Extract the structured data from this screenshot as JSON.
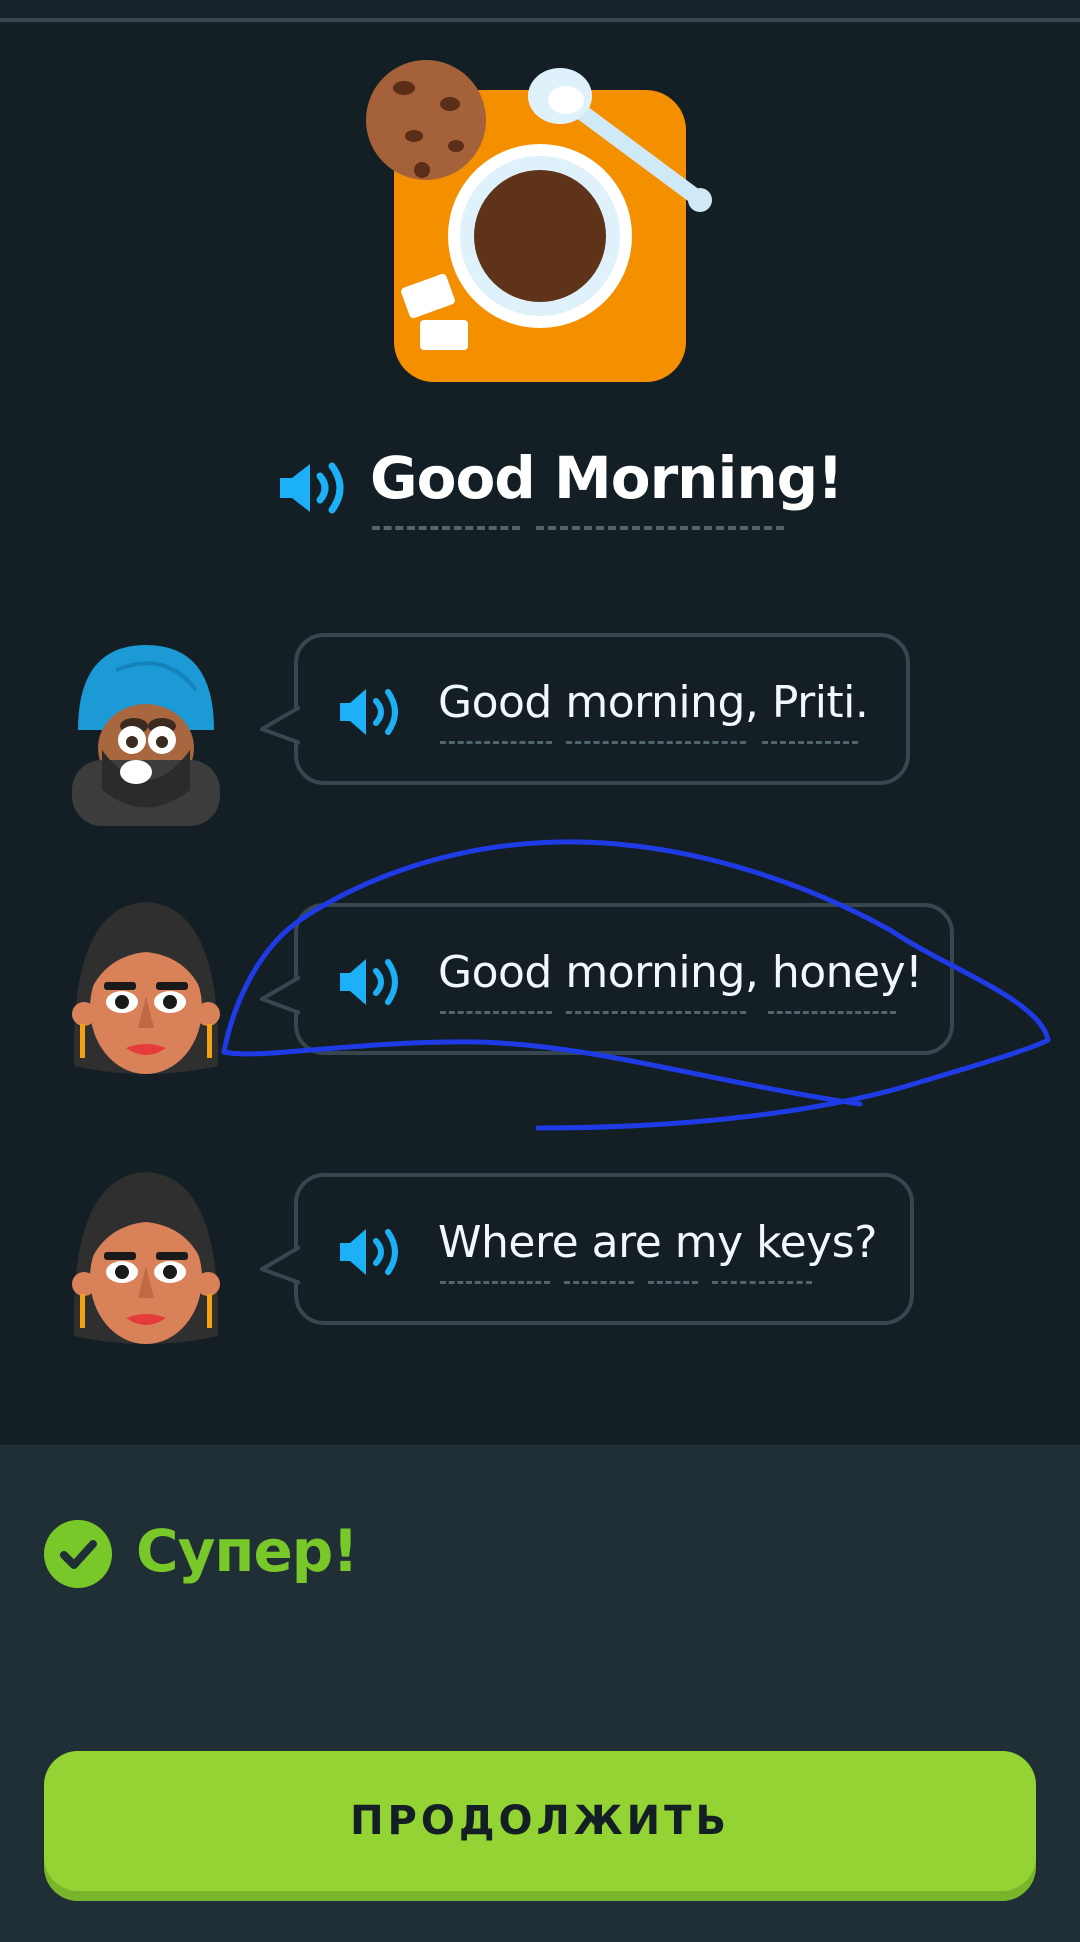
{
  "header": {
    "title": "Good Morning!"
  },
  "dialogue": [
    {
      "speaker": "man-with-turban",
      "text": "Good morning, Priti."
    },
    {
      "speaker": "woman",
      "text": "Good morning, honey!"
    },
    {
      "speaker": "woman",
      "text": "Where are my keys?"
    }
  ],
  "feedback": {
    "message": "Супер!"
  },
  "actions": {
    "continue_label": "ПРОДОЛЖИТЬ"
  },
  "colors": {
    "background": "#131f24",
    "sheet": "#202f36",
    "accent_blue": "#1cb0f6",
    "success_green": "#79c82a",
    "button_green": "#93d333",
    "annotation_stroke": "#1f3be6"
  }
}
